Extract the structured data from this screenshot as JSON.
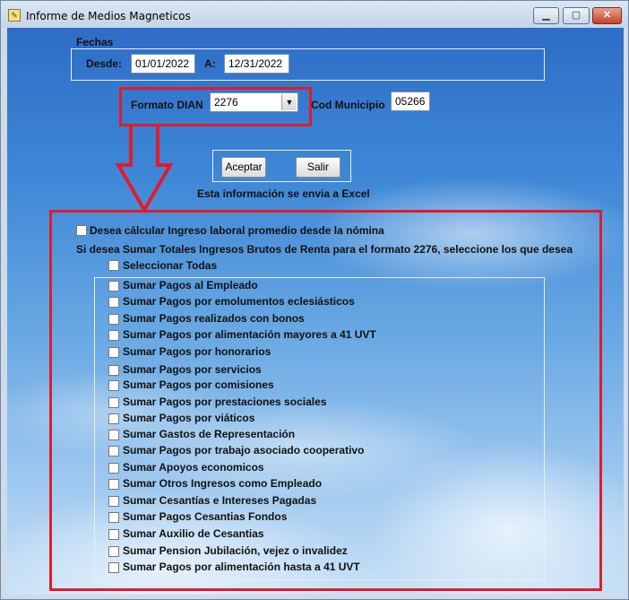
{
  "window": {
    "title": "Informe de Medios Magneticos",
    "minimize": "▁",
    "maximize": "▢",
    "close": "✕"
  },
  "fechas": {
    "group_label": "Fechas",
    "desde_label": "Desde:",
    "desde_value": "01/01/2022",
    "a_label": "A:",
    "a_value": "12/31/2022"
  },
  "formato": {
    "label": "Formato DIAN",
    "selected": "2276",
    "arrow": "▼"
  },
  "municipio": {
    "label": "Cod Municipio",
    "value": "05266"
  },
  "actions": {
    "aceptar": "Aceptar",
    "salir": "Salir",
    "note": "Esta información se envia a Excel"
  },
  "options": {
    "promedio_label": "Desea cálcular Ingreso laboral promedio desde la nómina",
    "instruction": "Si desea Sumar Totales Ingresos Brutos de  Renta para el formato 2276, seleccione los que desea",
    "select_all": "Seleccionar Todas",
    "items": [
      "Sumar Pagos al Empleado",
      "Sumar Pagos por emolumentos eclesiásticos",
      "Sumar Pagos realizados con bonos",
      "Sumar Pagos por alimentación mayores a 41 UVT",
      "Sumar Pagos por honorarios",
      "Sumar Pagos por servicios",
      "Sumar Pagos por comisiones",
      "Sumar Pagos por prestaciones sociales",
      "Sumar Pagos por viáticos",
      "Sumar Gastos de Representación",
      "Sumar Pagos por trabajo asociado cooperativo",
      "Sumar Apoyos economicos",
      "Sumar Otros Ingresos como Empleado",
      "Sumar Cesantías e Intereses Pagadas",
      "Sumar Pagos Cesantias Fondos",
      "Sumar Auxilio de Cesantias",
      "Sumar Pension Jubilación, vejez o invalidez",
      "Sumar Pagos por alimentación hasta a 41 UVT"
    ]
  }
}
